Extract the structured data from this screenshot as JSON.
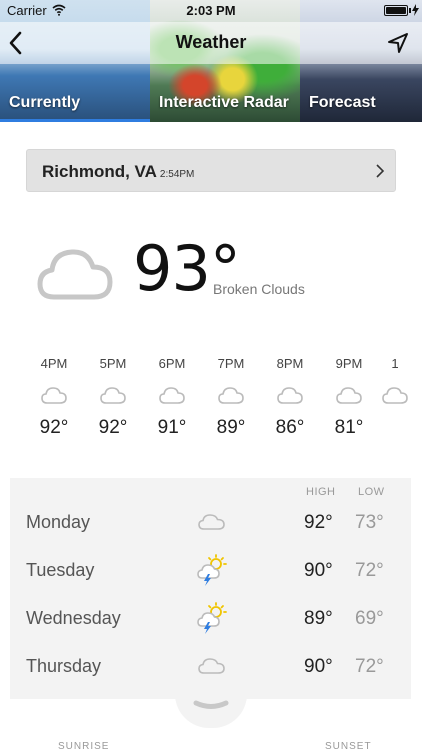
{
  "status_bar": {
    "carrier": "Carrier",
    "time": "2:03 PM"
  },
  "header": {
    "title": "Weather",
    "tabs": [
      {
        "label": "Currently"
      },
      {
        "label": "Interactive Radar"
      },
      {
        "label": "Forecast"
      }
    ],
    "active_tab": "Currently",
    "accent_color": "#2f7de0"
  },
  "location": {
    "name": "Richmond, VA",
    "time": "2:54PM"
  },
  "current": {
    "temp": "93°",
    "condition": "Broken Clouds",
    "icon": "cloud-icon"
  },
  "hourly": [
    {
      "time": "4PM",
      "temp": "92°",
      "icon": "cloud-icon"
    },
    {
      "time": "5PM",
      "temp": "92°",
      "icon": "cloud-icon"
    },
    {
      "time": "6PM",
      "temp": "91°",
      "icon": "cloud-icon"
    },
    {
      "time": "7PM",
      "temp": "89°",
      "icon": "cloud-icon"
    },
    {
      "time": "8PM",
      "temp": "86°",
      "icon": "cloud-icon"
    },
    {
      "time": "9PM",
      "temp": "81°",
      "icon": "cloud-icon"
    },
    {
      "time": "1",
      "temp": "",
      "icon": "cloud-icon"
    }
  ],
  "daily": {
    "high_label": "HIGH",
    "low_label": "LOW",
    "days": [
      {
        "day": "Monday",
        "high": "92°",
        "low": "73°",
        "icon": "cloud-icon"
      },
      {
        "day": "Tuesday",
        "high": "90°",
        "low": "72°",
        "icon": "thunderstorm-sun-icon"
      },
      {
        "day": "Wednesday",
        "high": "89°",
        "low": "69°",
        "icon": "thunderstorm-sun-icon"
      },
      {
        "day": "Thursday",
        "high": "90°",
        "low": "72°",
        "icon": "cloud-icon"
      }
    ]
  },
  "sun": {
    "sunrise_label": "SUNRISE",
    "sunset_label": "SUNSET"
  }
}
